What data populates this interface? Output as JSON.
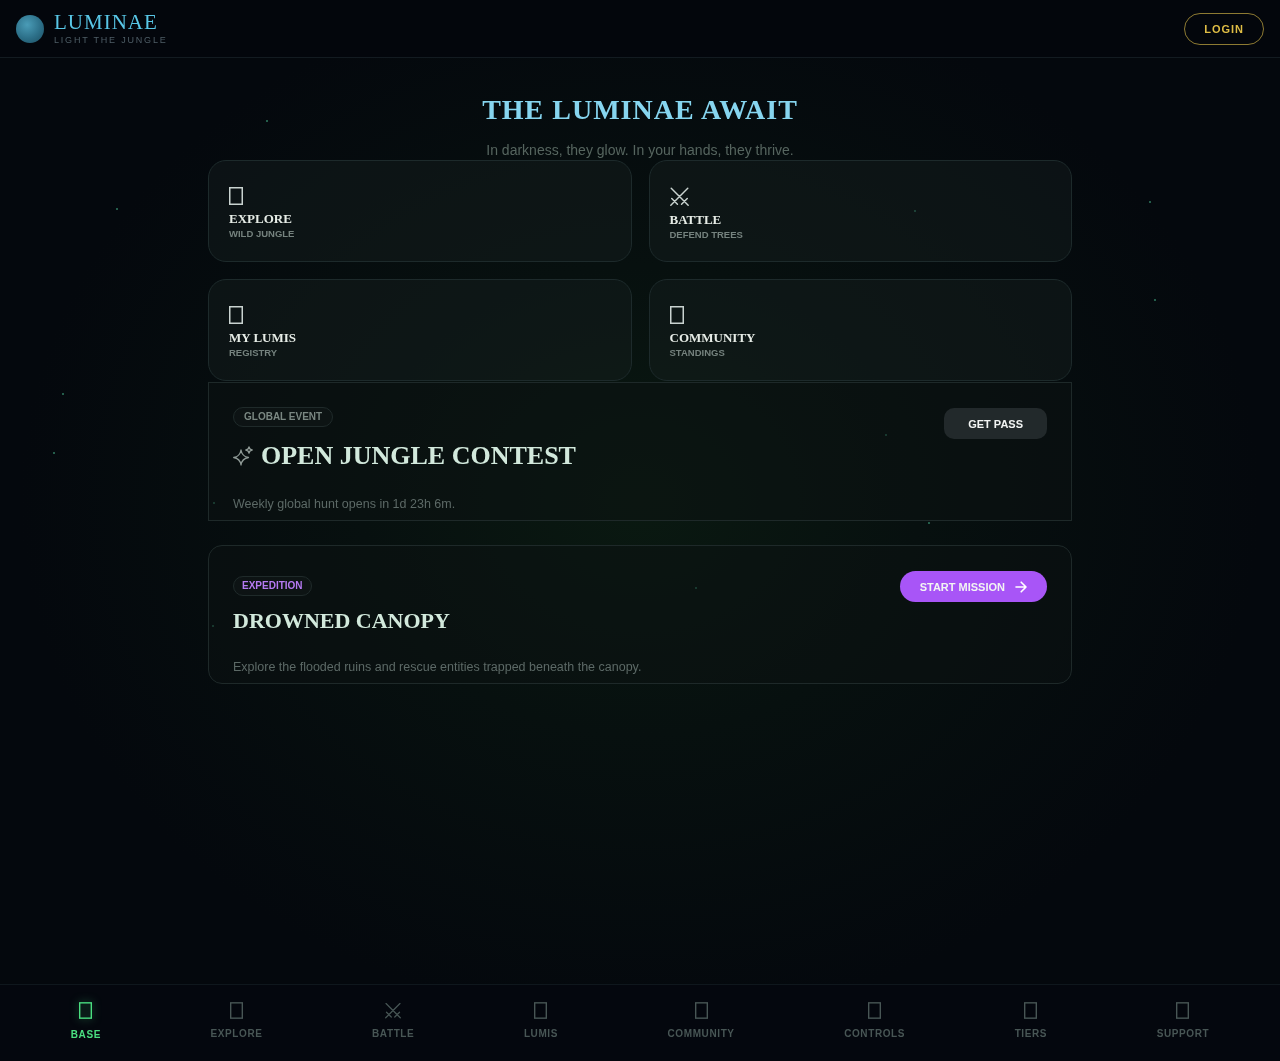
{
  "header": {
    "logo": {
      "name": "LUMINAE",
      "tagline": "LIGHT THE JUNGLE"
    },
    "login_button": "LOGIN"
  },
  "hero": {
    "title": "THE LUMINAE AWAIT",
    "subtitle": "In darkness, they glow. In your hands, they thrive."
  },
  "menu_cards": [
    {
      "title": "EXPLORE",
      "subtitle": "WILD JUNGLE"
    },
    {
      "title": "BATTLE",
      "subtitle": "DEFEND TREES"
    },
    {
      "title": "MY LUMIS",
      "subtitle": "REGISTRY"
    },
    {
      "title": "COMMUNITY",
      "subtitle": "STANDINGS"
    }
  ],
  "events": [
    {
      "kind": "global",
      "badge": "GLOBAL EVENT",
      "title": "OPEN JUNGLE CONTEST",
      "description": "Weekly global hunt opens in 1d 23h 6m.",
      "button": "GET PASS"
    },
    {
      "kind": "expedition",
      "badge": "EXPEDITION",
      "title": "DROWNED CANOPY",
      "description": "Explore the flooded ruins and rescue entities trapped beneath the canopy.",
      "button": "START MISSION"
    }
  ],
  "bottom_nav": [
    {
      "label": "BASE",
      "selected": true
    },
    {
      "label": "EXPLORE",
      "selected": false
    },
    {
      "label": "BATTLE",
      "selected": false
    },
    {
      "label": "LUMIS",
      "selected": false
    },
    {
      "label": "COMMUNITY",
      "selected": false
    },
    {
      "label": "CONTROLS",
      "selected": false
    },
    {
      "label": "TIERS",
      "selected": false
    },
    {
      "label": "SUPPORT",
      "selected": false
    }
  ]
}
